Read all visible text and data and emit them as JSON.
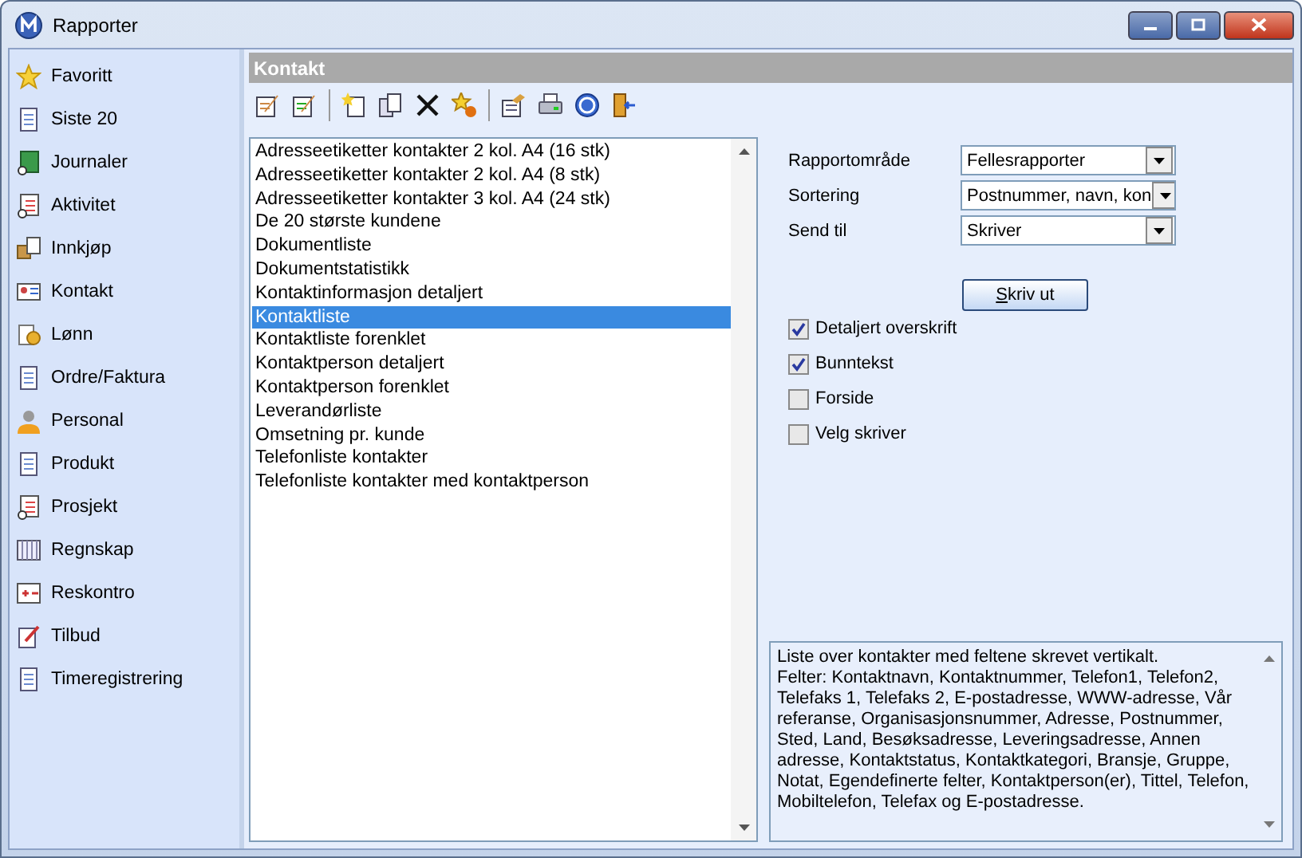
{
  "window": {
    "title": "Rapporter"
  },
  "sidebar": {
    "items": [
      {
        "label": "Favoritt"
      },
      {
        "label": "Siste 20"
      },
      {
        "label": "Journaler"
      },
      {
        "label": "Aktivitet"
      },
      {
        "label": "Innkjøp"
      },
      {
        "label": "Kontakt"
      },
      {
        "label": "Lønn"
      },
      {
        "label": "Ordre/Faktura"
      },
      {
        "label": "Personal"
      },
      {
        "label": "Produkt"
      },
      {
        "label": "Prosjekt"
      },
      {
        "label": "Regnskap"
      },
      {
        "label": "Reskontro"
      },
      {
        "label": "Tilbud"
      },
      {
        "label": "Timeregistrering"
      }
    ]
  },
  "panel": {
    "title": "Kontakt"
  },
  "reports": [
    {
      "label": "Adresseetiketter kontakter 2 kol. A4 (16 stk)",
      "selected": false
    },
    {
      "label": "Adresseetiketter kontakter 2 kol. A4 (8 stk)",
      "selected": false
    },
    {
      "label": "Adresseetiketter kontakter 3 kol. A4 (24 stk)",
      "selected": false
    },
    {
      "label": "De 20 største kundene",
      "selected": false
    },
    {
      "label": "Dokumentliste",
      "selected": false
    },
    {
      "label": "Dokumentstatistikk",
      "selected": false
    },
    {
      "label": "Kontaktinformasjon detaljert",
      "selected": false
    },
    {
      "label": "Kontaktliste",
      "selected": true
    },
    {
      "label": "Kontaktliste forenklet",
      "selected": false
    },
    {
      "label": "Kontaktperson detaljert",
      "selected": false
    },
    {
      "label": "Kontaktperson forenklet",
      "selected": false
    },
    {
      "label": "Leverandørliste",
      "selected": false
    },
    {
      "label": "Omsetning pr. kunde",
      "selected": false
    },
    {
      "label": "Telefonliste kontakter",
      "selected": false
    },
    {
      "label": "Telefonliste kontakter med kontaktperson",
      "selected": false
    }
  ],
  "settings": [
    {
      "label": "Rapportområde",
      "value": "Fellesrapporter"
    },
    {
      "label": "Sortering",
      "value": "Postnummer, navn, kon"
    },
    {
      "label": "Send til",
      "value": "Skriver"
    }
  ],
  "print_button": "Skriv ut",
  "options": [
    {
      "label": "Detaljert overskrift",
      "checked": true
    },
    {
      "label": "Bunntekst",
      "checked": true
    },
    {
      "label": "Forside",
      "checked": false
    },
    {
      "label": "Velg skriver",
      "checked": false
    }
  ],
  "description": "Liste over kontakter med feltene skrevet vertikalt.\nFelter: Kontaktnavn, Kontaktnummer, Telefon1, Telefon2, Telefaks 1, Telefaks 2, E-postadresse, WWW-adresse, Vår referanse, Organisasjonsnummer, Adresse, Postnummer, Sted, Land, Besøksadresse, Leveringsadresse, Annen adresse, Kontaktstatus, Kontaktkategori, Bransje, Gruppe, Notat, Egendefinerte felter, Kontaktperson(er), Tittel, Telefon, Mobiltelefon, Telefax og E-postadresse."
}
